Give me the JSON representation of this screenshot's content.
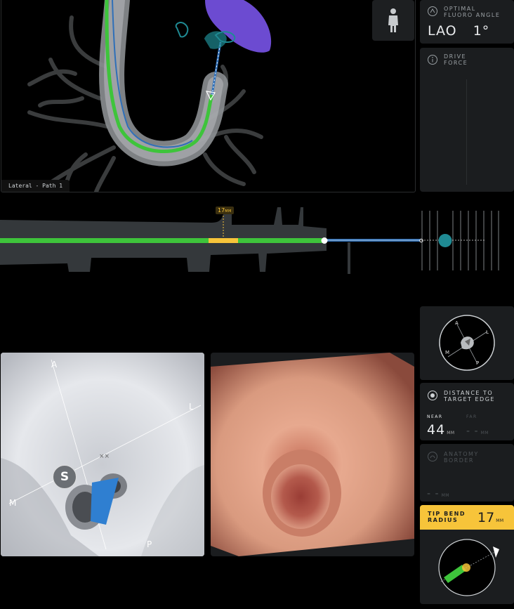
{
  "main_view": {
    "label": "Lateral - Path 1"
  },
  "patient_icon": "person-icon",
  "fluoro": {
    "title_line1": "OPTIMAL",
    "title_line2": "FLUORO ANGLE",
    "direction": "LAO",
    "angle": "1°"
  },
  "drive_force": {
    "title_line1": "DRIVE",
    "title_line2": "FORCE"
  },
  "path_strip": {
    "marker_value": "17",
    "marker_unit": "MM"
  },
  "orientation": {
    "A": "A",
    "L": "L",
    "M": "M",
    "P": "P",
    "S": "S"
  },
  "distance": {
    "title_line1": "DISTANCE TO",
    "title_line2": "TARGET EDGE",
    "near_label": "NEAR",
    "near_value": "44",
    "near_unit": "MM",
    "far_label": "FAR",
    "far_value": "- -",
    "far_unit": "MM"
  },
  "anatomy": {
    "title_line1": "ANATOMY",
    "title_line2": "BORDER",
    "value": "- -",
    "unit": "MM"
  },
  "tip_bend": {
    "title_line1": "TIP BEND",
    "title_line2": "RADIUS",
    "value": "17",
    "unit": "MM"
  },
  "colors": {
    "accent_yellow": "#f7c43a",
    "path_green": "#3ec43b",
    "path_blue": "#2f6fb8",
    "target_purple": "#6c4bd1",
    "target_teal": "#1f8a93"
  }
}
